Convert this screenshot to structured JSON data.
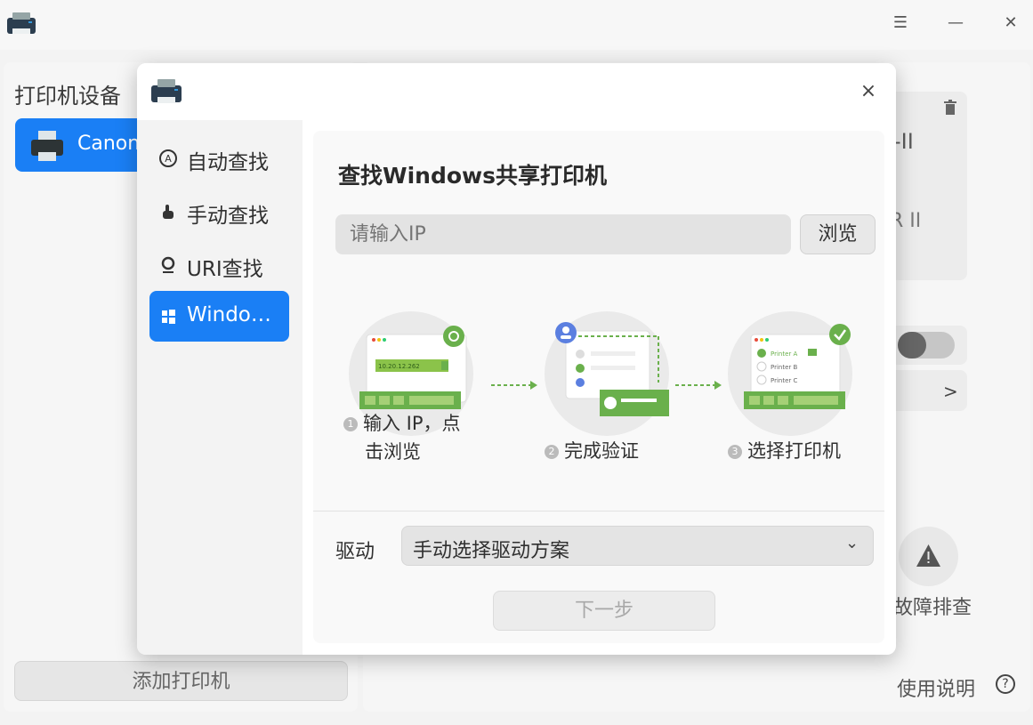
{
  "window": {
    "icon": "printer-app-icon",
    "menu_icon": "hamburger-menu-icon",
    "minimize_icon": "minimize-icon",
    "close_icon": "close-icon"
  },
  "left_panel": {
    "title": "打印机设备",
    "printers": [
      {
        "label": "Canon",
        "icon": "printer-icon",
        "selected": true
      }
    ],
    "add_button": "添加打印机"
  },
  "right_panel": {
    "text1": "-II",
    "text2": "R II",
    "toggle_on": false,
    "troubleshoot_label": "故障排查",
    "help_label": "使用说明",
    "help_icon": "question-circle-icon"
  },
  "dialog": {
    "close_glyph": "×",
    "nav": [
      {
        "label": "自动查找",
        "icon": "auto-search-icon",
        "active": false
      },
      {
        "label": "手动查找",
        "icon": "hand-pointer-icon",
        "active": false
      },
      {
        "label": "URI查找",
        "icon": "location-pin-icon",
        "active": false
      },
      {
        "label": "Windo…",
        "icon": "windows-logo-icon",
        "active": true
      }
    ],
    "title": "查找Windows共享打印机",
    "ip_placeholder": "请输入IP",
    "browse_button": "浏览",
    "steps": [
      {
        "num": "1",
        "label_line1": "输入 IP，点",
        "label_line2": "击浏览",
        "ip_example": "10.20.12.262"
      },
      {
        "num": "2",
        "label": "完成验证"
      },
      {
        "num": "3",
        "label": "选择打印机",
        "printers": [
          "Printer A",
          "Printer B",
          "Printer C"
        ]
      }
    ],
    "driver_label": "驱动",
    "driver_value": "手动选择驱动方案",
    "next_button": "下一步",
    "accent": "#1a7ff5",
    "green": "#6ab04c"
  }
}
